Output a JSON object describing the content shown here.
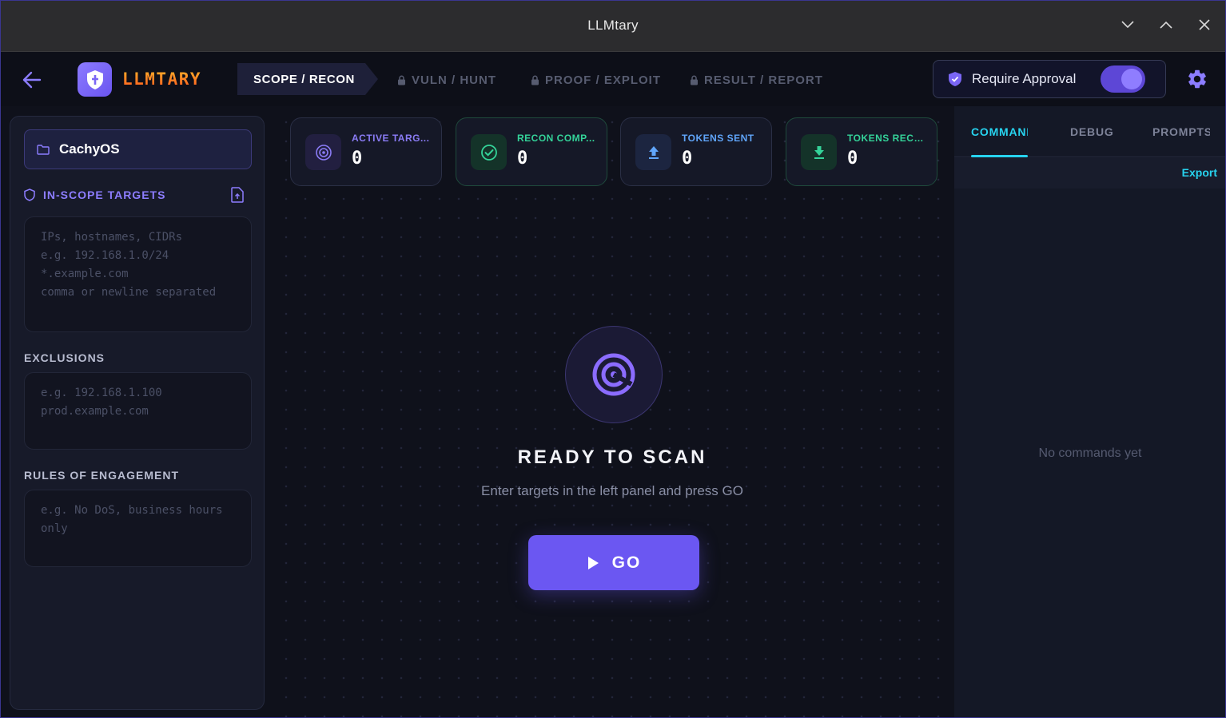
{
  "window": {
    "title": "LLMtary"
  },
  "header": {
    "logo_text": "LLMTARY",
    "phases": [
      {
        "label": "SCOPE / RECON",
        "active": true
      },
      {
        "label": "VULN / HUNT",
        "locked": true
      },
      {
        "label": "PROOF / EXPLOIT",
        "locked": true
      },
      {
        "label": "RESULT / REPORT",
        "locked": true
      }
    ],
    "approval_label": "Require Approval",
    "approval_enabled": true
  },
  "left_panel": {
    "project_name": "CachyOS",
    "scope_label": "IN-SCOPE TARGETS",
    "scope_placeholder": "IPs, hostnames, CIDRs\ne.g. 192.168.1.0/24\n*.example.com\ncomma or newline separated",
    "exclusions_label": "EXCLUSIONS",
    "exclusions_placeholder": "e.g. 192.168.1.100\nprod.example.com",
    "roe_label": "RULES OF ENGAGEMENT",
    "roe_placeholder": "e.g. No DoS, business hours only"
  },
  "stats": [
    {
      "label": "ACTIVE TARG...",
      "value": "0",
      "color": "#8b7cf6",
      "icon": "radar-icon"
    },
    {
      "label": "RECON COMP...",
      "value": "0",
      "color": "#34d399",
      "icon": "check-circle-icon"
    },
    {
      "label": "TOKENS SENT",
      "value": "0",
      "color": "#60a5fa",
      "icon": "upload-icon"
    },
    {
      "label": "TOKENS RECE...",
      "value": "0",
      "color": "#34d399",
      "icon": "download-icon"
    }
  ],
  "main": {
    "title": "READY TO SCAN",
    "subtitle": "Enter targets in the left panel and press GO",
    "go_label": "GO"
  },
  "right_panel": {
    "tabs": [
      {
        "label": "COMMANDS",
        "active": true
      },
      {
        "label": "DEBUG",
        "active": false
      },
      {
        "label": "PROMPTS",
        "active": false
      }
    ],
    "export_label": "Export",
    "empty_message": "No commands yet"
  },
  "colors": {
    "accent": "#6b57f2",
    "cyan": "#27d3ef",
    "background": "#0f111b"
  }
}
